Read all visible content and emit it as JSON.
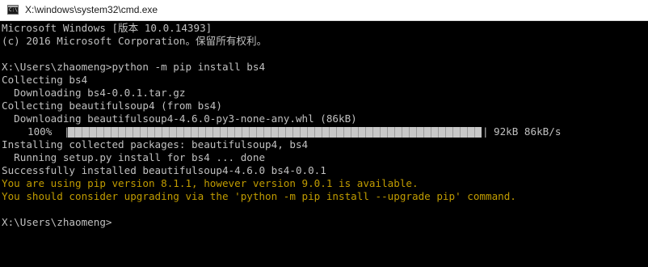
{
  "window": {
    "title": "X:\\windows\\system32\\cmd.exe"
  },
  "console": {
    "lines": [
      {
        "text": "Microsoft Windows [版本 10.0.14393]",
        "kind": "normal"
      },
      {
        "text": "(c) 2016 Microsoft Corporation。保留所有权利。",
        "kind": "normal"
      },
      {
        "text": "",
        "kind": "normal"
      },
      {
        "text": "X:\\Users\\zhaomeng>python -m pip install bs4",
        "kind": "normal"
      },
      {
        "text": "Collecting bs4",
        "kind": "normal"
      },
      {
        "text": "  Downloading bs4-0.0.1.tar.gz",
        "kind": "normal"
      },
      {
        "text": "Collecting beautifulsoup4 (from bs4)",
        "kind": "normal"
      },
      {
        "text": "  Downloading beautifulsoup4-4.6.0-py3-none-any.whl (86kB)",
        "kind": "normal"
      }
    ],
    "progress": {
      "percent_label": "100%",
      "bar_left": "|",
      "bar_right": "|",
      "fraction": 1.0,
      "stats": "92kB 86kB/s"
    },
    "lines_after": [
      {
        "text": "Installing collected packages: beautifulsoup4, bs4",
        "kind": "normal"
      },
      {
        "text": "  Running setup.py install for bs4 ... done",
        "kind": "normal"
      },
      {
        "text": "Successfully installed beautifulsoup4-4.6.0 bs4-0.0.1",
        "kind": "normal"
      },
      {
        "text": "You are using pip version 8.1.1, however version 9.0.1 is available.",
        "kind": "warn"
      },
      {
        "text": "You should consider upgrading via the 'python -m pip install --upgrade pip' command.",
        "kind": "warn"
      },
      {
        "text": "",
        "kind": "normal"
      }
    ],
    "prompt": "X:\\Users\\zhaomeng>"
  },
  "colors": {
    "background": "#000000",
    "text": "#c0c0c0",
    "warning": "#c19c00"
  }
}
